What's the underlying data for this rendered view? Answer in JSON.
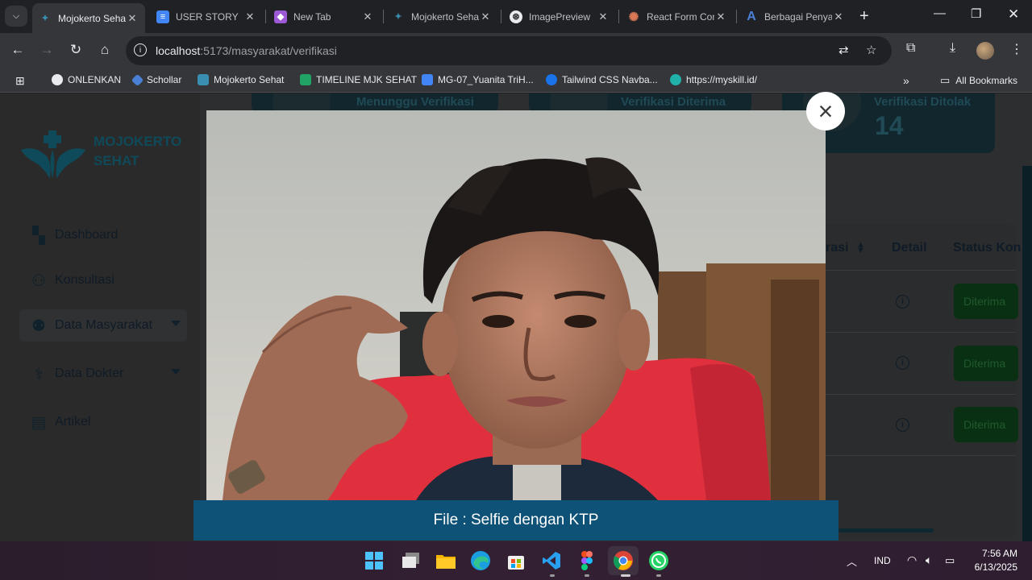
{
  "browser": {
    "tabs": [
      {
        "title": "Mojokerto Sehat",
        "active": true
      },
      {
        "title": "USER STORY",
        "active": false
      },
      {
        "title": "New Tab",
        "active": false
      },
      {
        "title": "Mojokerto Sehat",
        "active": false
      },
      {
        "title": "ImagePreview",
        "active": false
      },
      {
        "title": "React Form Component",
        "active": false
      },
      {
        "title": "Berbagai Penyakit",
        "active": false
      }
    ],
    "url_host": "localhost",
    "url_path": ":5173/masyarakat/verifikasi",
    "bookmarks": [
      {
        "label": "ONLENKAN",
        "color": "#e8eaed"
      },
      {
        "label": "Schollar",
        "color": "#4a7fd6"
      },
      {
        "label": "Mojokerto Sehat",
        "color": "#3a8fb0"
      },
      {
        "label": "TIMELINE MJK SEHAT",
        "color": "#21a366"
      },
      {
        "label": "MG-07_Yuanita TriH...",
        "color": "#4285f4"
      },
      {
        "label": "Tailwind CSS Navba...",
        "color": "#1a73e8"
      },
      {
        "label": "https://myskill.id/",
        "color": "#20b2aa"
      }
    ],
    "all_bookmarks_label": "All Bookmarks"
  },
  "sidebar": {
    "logo_text_line1": "MOJOKERTO",
    "logo_text_line2": "SEHAT",
    "items": [
      {
        "label": "Dashboard",
        "icon": "dashboard-icon"
      },
      {
        "label": "Konsultasi",
        "icon": "consultation-icon"
      },
      {
        "label": "Data Masyarakat",
        "icon": "people-icon"
      },
      {
        "label": "Data Dokter",
        "icon": "doctor-icon"
      },
      {
        "label": "Artikel",
        "icon": "article-icon"
      }
    ]
  },
  "stats": {
    "pending_label": "Menunggu Verifikasi",
    "accepted_label": "Verifikasi Diterima",
    "rejected_label": "Verifikasi Ditolak",
    "rejected_value": "14"
  },
  "table": {
    "headers": {
      "registration_partial": "rasi",
      "detail": "Detail",
      "status": "Status Kon"
    },
    "rows": [
      {
        "status": "Diterima"
      },
      {
        "status": "Diterima"
      },
      {
        "status": "Diterima"
      }
    ]
  },
  "modal": {
    "caption": "File : Selfie dengan KTP",
    "close_symbol": "×"
  },
  "taskbar": {
    "language": "IND",
    "time": "7:56 AM",
    "date": "6/13/2025"
  },
  "colors": {
    "modal_caption_bg": "#0e5278",
    "status_badge_bg": "#0a3014",
    "brand_dark": "#0e4a5a"
  }
}
